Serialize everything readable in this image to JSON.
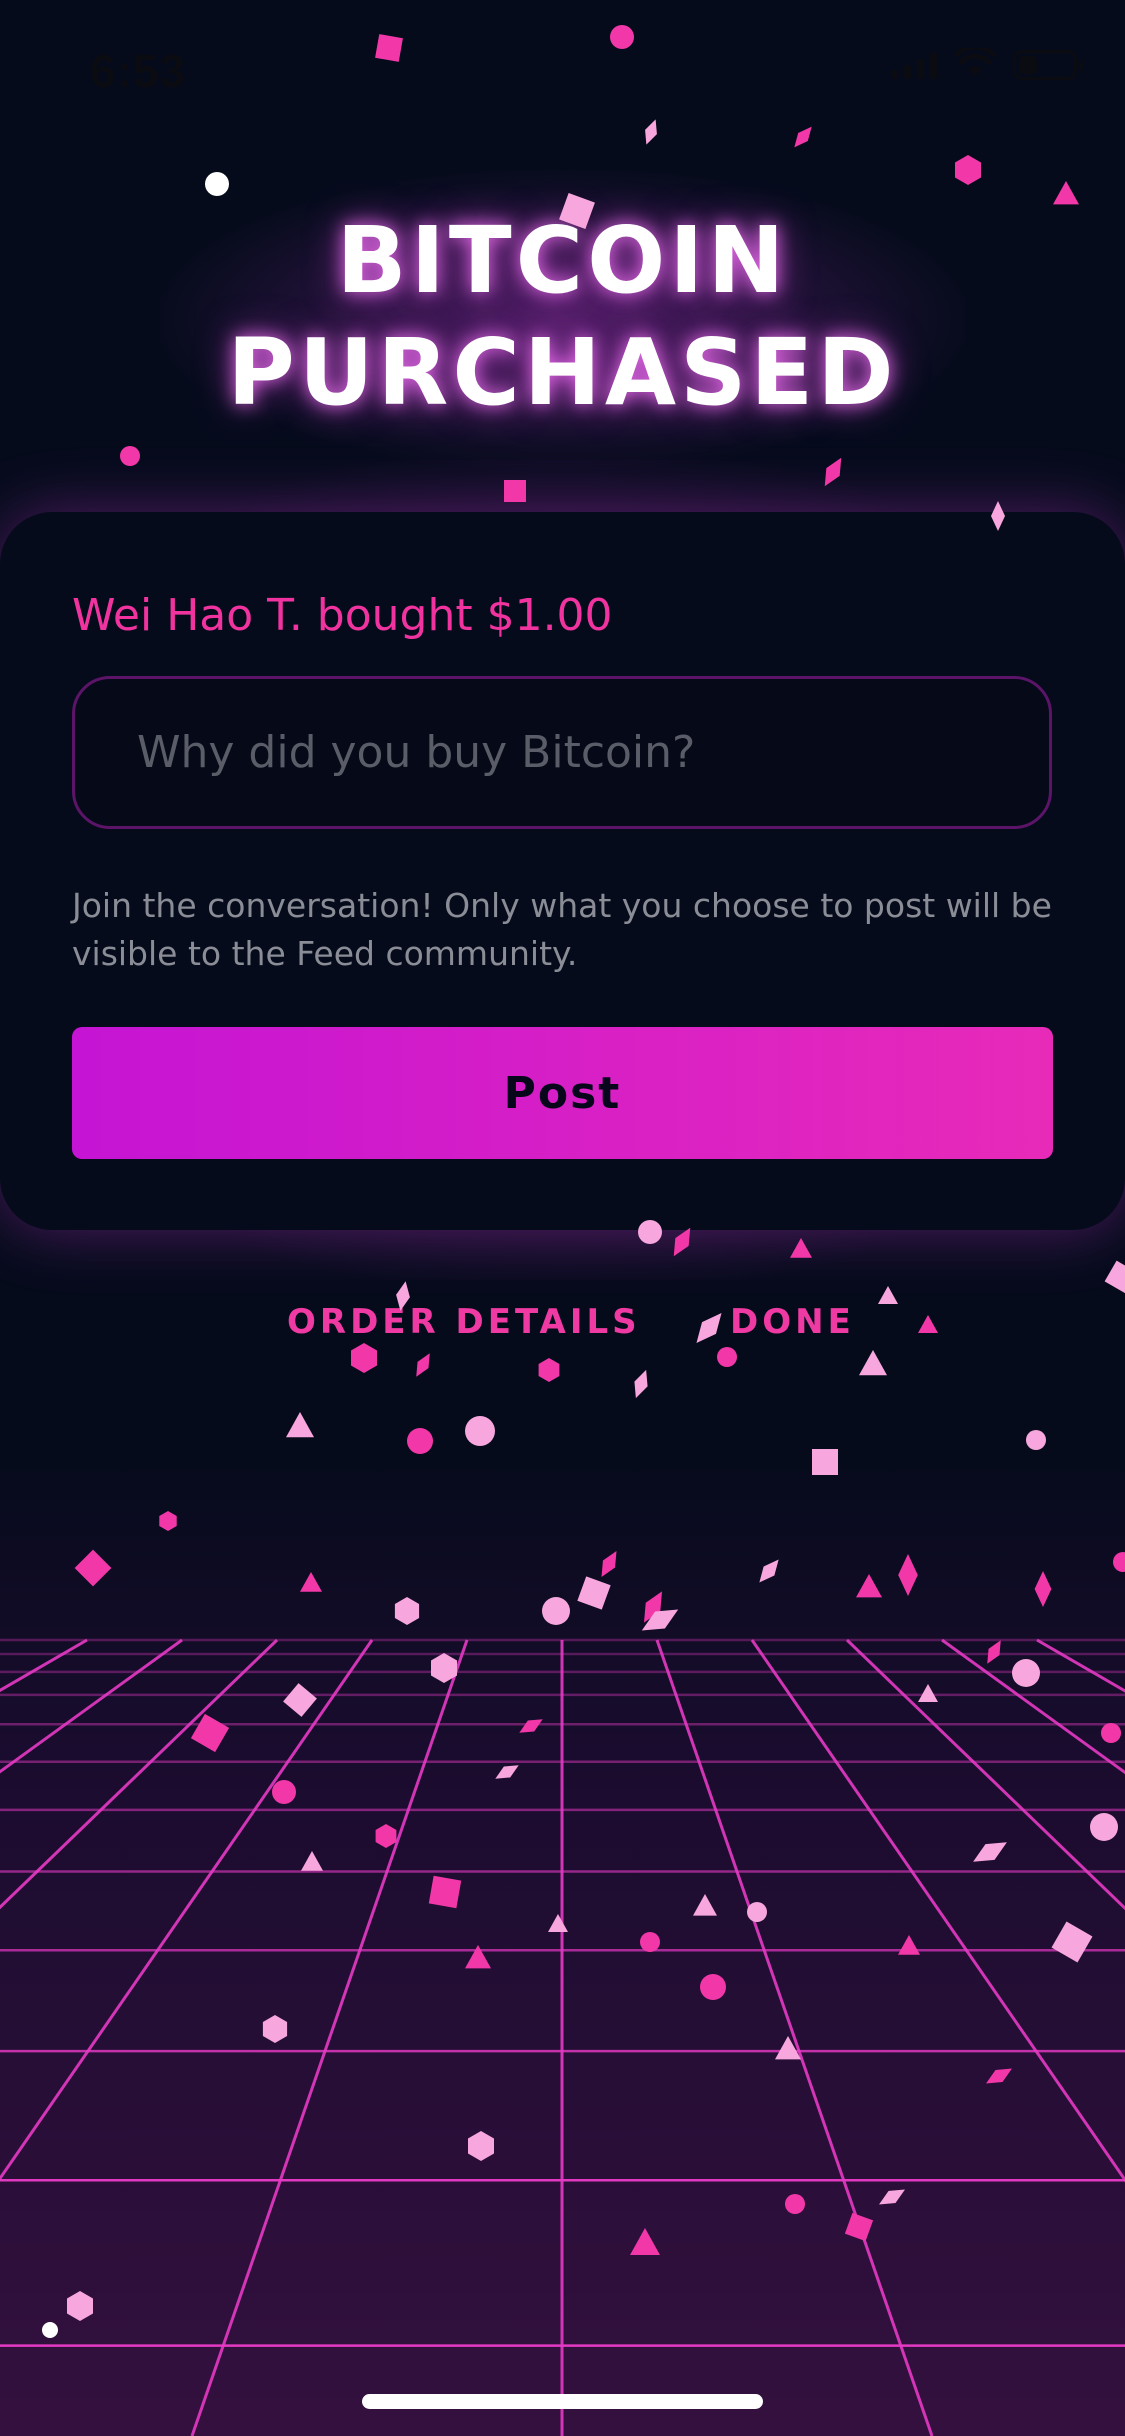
{
  "status_bar": {
    "time": "6:53",
    "icons": [
      "signal-icon",
      "wifi-icon",
      "battery-icon"
    ]
  },
  "headline": {
    "line1": "BITCOIN",
    "line2": "PURCHASED"
  },
  "card": {
    "purchase_text": "Wei Hao T. bought $1.00",
    "reason_input": {
      "value": "",
      "placeholder": "Why did you buy Bitcoin?"
    },
    "helper_text": "Join the conversation! Only what you choose to post will be visible to the Feed community.",
    "post_label": "Post"
  },
  "links": {
    "order_details": "ORDER DETAILS",
    "done": "DONE"
  },
  "colors": {
    "background": "#060b1c",
    "accent_pink": "#ef3aa3",
    "button_gradient_start": "#c514d4",
    "button_gradient_end": "#e82ab9",
    "grid_line": "#e53ac4",
    "floor": "#34103f"
  }
}
